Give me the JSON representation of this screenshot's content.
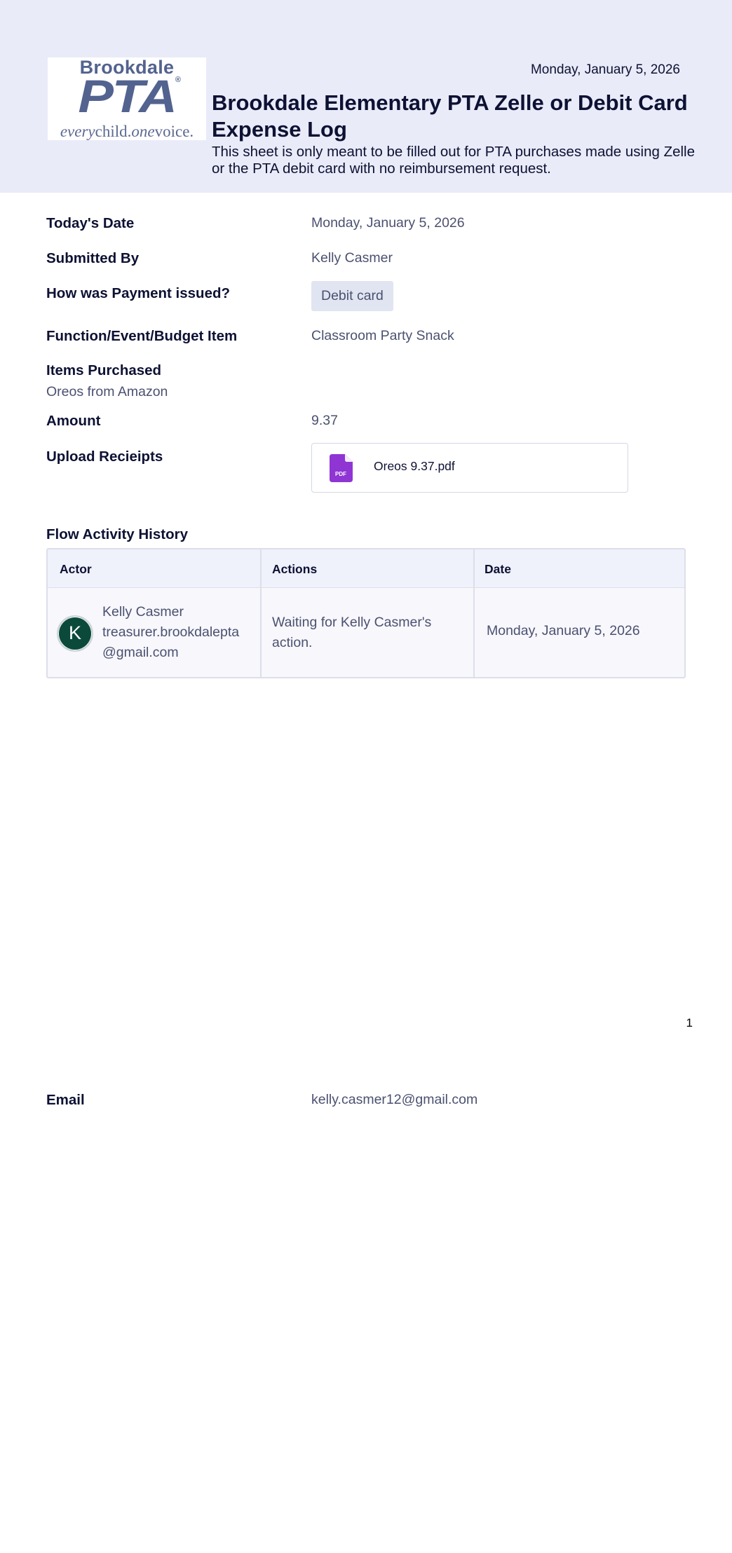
{
  "logo": {
    "top": "Brookdale",
    "middle": "PTA",
    "registered": "®",
    "bottom_every": "every",
    "bottom_child": "child.",
    "bottom_one": "one",
    "bottom_voice": "voice."
  },
  "header": {
    "date": "Monday, January 5, 2026",
    "title": "Brookdale Elementary PTA Zelle or Debit Card Expense Log",
    "subtitle": "This sheet is only meant to be filled out for PTA purchases made using Zelle or the PTA debit card with no reimbursement request."
  },
  "form": {
    "todays_date": {
      "label": "Today's Date",
      "value": "Monday, January 5, 2026"
    },
    "submitted_by": {
      "label": "Submitted By",
      "value": "Kelly Casmer"
    },
    "payment": {
      "label": "How was Payment issued?",
      "value": "Debit card"
    },
    "function": {
      "label": "Function/Event/Budget Item",
      "value": "Classroom Party Snack"
    },
    "items": {
      "label": "Items Purchased",
      "value": "Oreos from Amazon"
    },
    "amount": {
      "label": "Amount",
      "value": "9.37"
    },
    "receipts": {
      "label": "Upload Recieipts",
      "file_name": "Oreos 9.37.pdf",
      "file_icon_text": "PDF",
      "icon": "pdf-file-icon",
      "icon_color": "#8f35d3"
    },
    "email": {
      "label": "Email",
      "value": "kelly.casmer12@gmail.com"
    }
  },
  "flow_history": {
    "title": "Flow Activity History",
    "columns": [
      "Actor",
      "Actions",
      "Date"
    ],
    "rows": [
      {
        "avatar_initial": "K",
        "avatar_color": "#0b4a3b",
        "actor_name": "Kelly Casmer",
        "actor_email_line1": "treasurer.brookdalepta",
        "actor_email_line2": "@gmail.com",
        "action": "Waiting for Kelly Casmer's action.",
        "date": "Monday, January 5, 2026"
      }
    ]
  },
  "footer": {
    "page_number": "1"
  },
  "colors": {
    "header_band": "#e9ebf8",
    "label_text": "#0d1133",
    "value_text": "#4b5170",
    "chip_bg": "#e1e5f1",
    "logo": "#53638f"
  }
}
